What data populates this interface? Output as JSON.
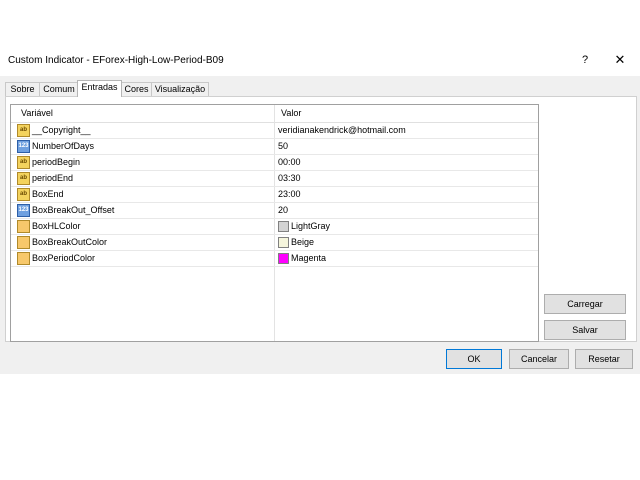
{
  "window": {
    "title": "Custom Indicator - EForex-High-Low-Period-B09",
    "help_label": "?",
    "close_label": "✕"
  },
  "tabs": [
    {
      "label": "Sobre"
    },
    {
      "label": "Comum"
    },
    {
      "label": "Entradas"
    },
    {
      "label": "Cores"
    },
    {
      "label": "Visualização"
    }
  ],
  "active_tab": "Entradas",
  "grid": {
    "headers": {
      "variable": "Variável",
      "value": "Valor"
    },
    "rows": [
      {
        "icon": "ab",
        "name": "__Copyright__",
        "value": "veridianakendrick@hotmail.com"
      },
      {
        "icon": "123",
        "name": "NumberOfDays",
        "value": "50"
      },
      {
        "icon": "ab",
        "name": "periodBegin",
        "value": "00:00"
      },
      {
        "icon": "ab",
        "name": "periodEnd",
        "value": "03:30"
      },
      {
        "icon": "ab",
        "name": "BoxEnd",
        "value": "23:00"
      },
      {
        "icon": "123",
        "name": "BoxBreakOut_Offset",
        "value": "20"
      },
      {
        "icon": "color",
        "name": "BoxHLColor",
        "value": "LightGray",
        "swatch": "#d3d3d3"
      },
      {
        "icon": "color",
        "name": "BoxBreakOutColor",
        "value": "Beige",
        "swatch": "#f5f5dc"
      },
      {
        "icon": "color",
        "name": "BoxPeriodColor",
        "value": "Magenta",
        "swatch": "#ff00ff"
      }
    ]
  },
  "buttons": {
    "load": "Carregar",
    "save": "Salvar",
    "ok": "OK",
    "cancel": "Cancelar",
    "reset": "Resetar"
  },
  "colors": {
    "accent": "#0078d7",
    "dialog_bg": "#f0f0f0"
  }
}
